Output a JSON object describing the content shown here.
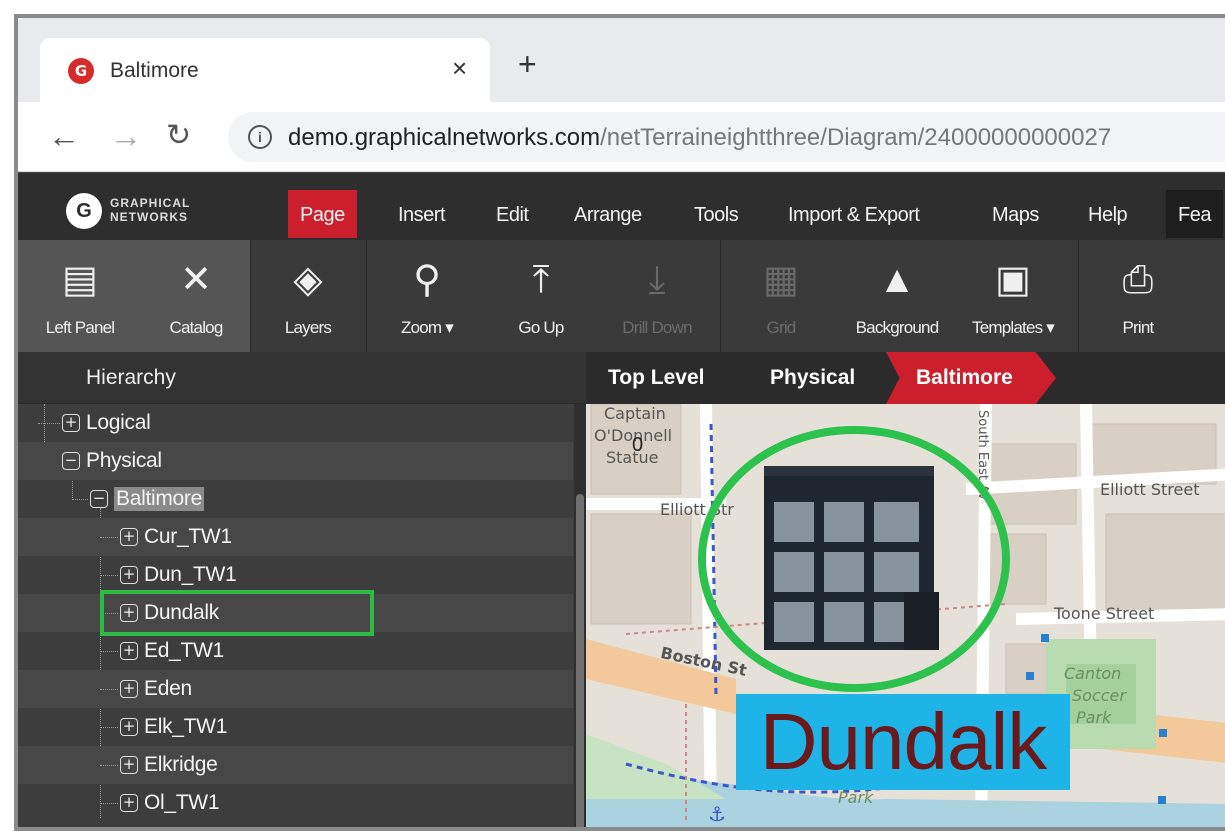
{
  "browser": {
    "tab_title": "Baltimore",
    "tab_favicon": "G",
    "tab_close": "×",
    "new_tab": "+",
    "url_host": "demo.graphicalnetworks.com",
    "url_path": "/netTerraineightthree/Diagram/24000000000027"
  },
  "app": {
    "logo_mark": "G",
    "logo_line1": "GRAPHICAL",
    "logo_line2": "NETWORKS",
    "menu": [
      {
        "label": "Page",
        "active": true
      },
      {
        "label": "Insert"
      },
      {
        "label": "Edit"
      },
      {
        "label": "Arrange"
      },
      {
        "label": "Tools"
      },
      {
        "label": "Import & Export"
      },
      {
        "label": "Maps"
      },
      {
        "label": "Help"
      },
      {
        "label": "Fea"
      }
    ],
    "toolbar": [
      {
        "label": "Left Panel",
        "icon": "left-panel-icon"
      },
      {
        "label": "Catalog",
        "icon": "tools-icon"
      },
      {
        "label": "Layers",
        "icon": "layers-icon"
      },
      {
        "label": "Zoom ▾",
        "icon": "zoom-icon"
      },
      {
        "label": "Go Up",
        "icon": "go-up-icon"
      },
      {
        "label": "Drill Down",
        "icon": "drill-down-icon",
        "disabled": true
      },
      {
        "label": "Grid",
        "icon": "grid-icon",
        "disabled": true
      },
      {
        "label": "Background",
        "icon": "image-icon"
      },
      {
        "label": "Templates ▾",
        "icon": "templates-icon"
      },
      {
        "label": "Print",
        "icon": "print-icon"
      }
    ]
  },
  "hierarchy": {
    "title": "Hierarchy",
    "items": [
      {
        "label": "Logical",
        "toggle": "+"
      },
      {
        "label": "Physical",
        "toggle": "−"
      },
      {
        "label": "Baltimore",
        "toggle": "−",
        "selected": true
      },
      {
        "label": "Cur_TW1",
        "toggle": "+"
      },
      {
        "label": "Dun_TW1",
        "toggle": "+"
      },
      {
        "label": "Dundalk",
        "toggle": "+",
        "highlighted": true
      },
      {
        "label": "Ed_TW1",
        "toggle": "+"
      },
      {
        "label": "Eden",
        "toggle": "+"
      },
      {
        "label": "Elk_TW1",
        "toggle": "+"
      },
      {
        "label": "Elkridge",
        "toggle": "+"
      },
      {
        "label": "Ol_TW1",
        "toggle": "+"
      }
    ]
  },
  "breadcrumb": [
    "Top Level",
    "Physical",
    "Baltimore"
  ],
  "map": {
    "labels": {
      "captain": "Captain",
      "odonnell": "O'Donnell",
      "statue": "Statue",
      "elliott_left": "Elliott Str",
      "elliott_right": "Elliott Street",
      "toone": "Toone Street",
      "boston": "Boston St",
      "canton": "Canton",
      "soccer": "Soccer",
      "park": "Park",
      "park2": "Park",
      "south_east": "South East Av"
    },
    "zero_label": "0",
    "node_label": "Dundalk"
  },
  "colors": {
    "accent": "#cc1f2e",
    "highlight": "#2dbb46",
    "label_bg": "#1fb4e8",
    "label_text": "#6a1a1a"
  }
}
